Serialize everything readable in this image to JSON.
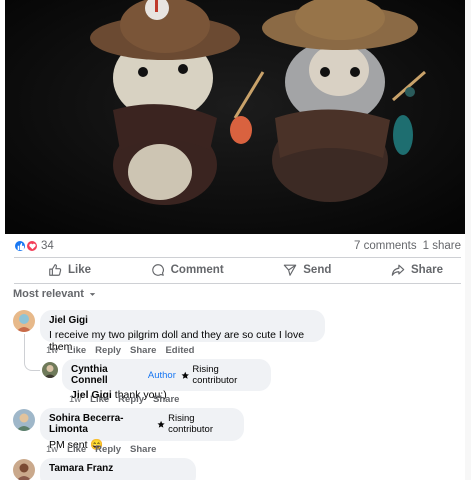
{
  "stats": {
    "reaction_count": "34",
    "comments": "7 comments",
    "shares": "1 share"
  },
  "actions": {
    "like": "Like",
    "comment": "Comment",
    "send": "Send",
    "share": "Share"
  },
  "sort_label": "Most relevant",
  "comments": [
    {
      "author": "Jiel Gigi",
      "text": "I receive my two pilgrim doll and they are so cute I love them",
      "time": "1w",
      "like": "Like",
      "reply": "Reply",
      "share": "Share",
      "edited": "Edited",
      "reply_item": {
        "author": "Cynthia Connell",
        "tag": "Author",
        "badge": "Rising contributor",
        "mention": "Jiel Gigi",
        "text": " thank you:)",
        "time": "1w",
        "like": "Like",
        "reply": "Reply",
        "share": "Share"
      }
    },
    {
      "author": "Sohira Becerra-Limonta",
      "badge": "Rising contributor",
      "text": "PM sent 😄",
      "time": "1w",
      "like": "Like",
      "reply": "Reply",
      "share": "Share"
    },
    {
      "author": "Tamara Franz"
    }
  ]
}
